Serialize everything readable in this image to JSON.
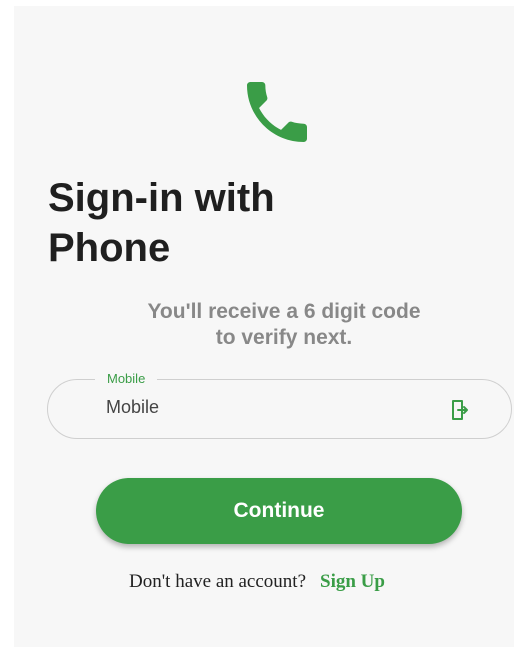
{
  "colors": {
    "accent": "#3a9d47",
    "background": "#f7f7f7",
    "title": "#1f1f1f",
    "subtitle": "#888888"
  },
  "header": {
    "icon": "phone-icon",
    "title": "Sign-in with\nPhone",
    "subtitle": "You'll receive a 6 digit code\nto verify next."
  },
  "form": {
    "mobile_label": "Mobile",
    "mobile_placeholder": "Mobile",
    "mobile_value": "",
    "field_icon": "phone-login-icon"
  },
  "actions": {
    "continue_label": "Continue"
  },
  "footer": {
    "prompt": "Don't have an account?",
    "signup_label": "Sign Up"
  }
}
